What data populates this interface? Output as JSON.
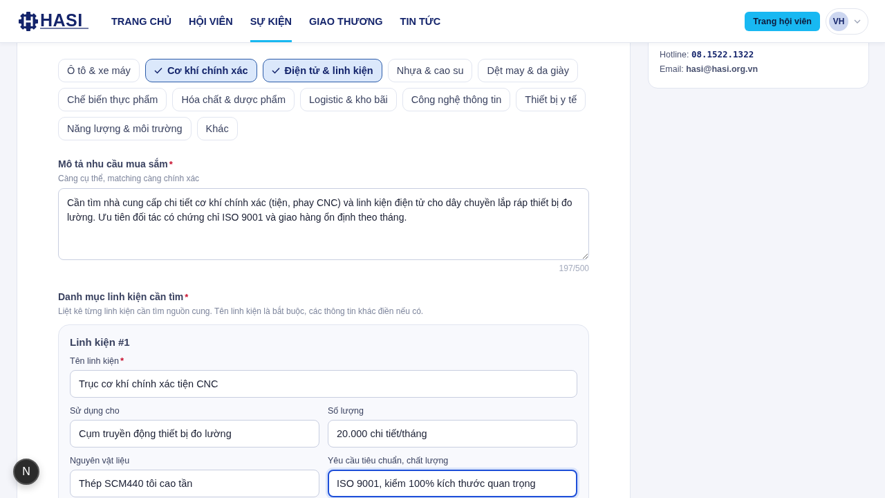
{
  "header": {
    "logo": "HASI",
    "nav": [
      {
        "label": "TRANG CHỦ",
        "selected": false
      },
      {
        "label": "HỘI VIÊN",
        "selected": false
      },
      {
        "label": "SỰ KIỆN",
        "selected": true
      },
      {
        "label": "GIAO THƯƠNG",
        "selected": false
      },
      {
        "label": "TIN TỨC",
        "selected": false
      }
    ],
    "member_button": "Trang hội viên",
    "avatar": "VH"
  },
  "form": {
    "industries": {
      "chips": [
        {
          "label": "Ô tô & xe máy",
          "selected": false
        },
        {
          "label": "Cơ khí chính xác",
          "selected": true
        },
        {
          "label": "Điện tử & linh kiện",
          "selected": true
        },
        {
          "label": "Nhựa & cao su",
          "selected": false
        },
        {
          "label": "Dệt may & da giày",
          "selected": false
        },
        {
          "label": "Chế biến thực phẩm",
          "selected": false
        },
        {
          "label": "Hóa chất & dược phẩm",
          "selected": false
        },
        {
          "label": "Logistic & kho bãi",
          "selected": false
        },
        {
          "label": "Công nghệ thông tin",
          "selected": false
        },
        {
          "label": "Thiết bị y tế",
          "selected": false
        },
        {
          "label": "Năng lượng & môi trường",
          "selected": false
        },
        {
          "label": "Khác",
          "selected": false
        }
      ]
    },
    "description": {
      "label": "Mô tả nhu cầu mua sắm",
      "required_mark": "*",
      "hint": "Càng cụ thể, matching càng chính xác",
      "value": "Cần tìm nhà cung cấp chi tiết cơ khí chính xác (tiện, phay CNC) và linh kiện điện tử cho dây chuyền lắp ráp thiết bị đo lường. Ưu tiên đối tác có chứng chỉ ISO 9001 và giao hàng ổn định theo tháng.",
      "counter": "197/500"
    },
    "components": {
      "label": "Danh mục linh kiện cần tìm",
      "required_mark": "*",
      "hint": "Liệt kê từng linh kiện cần tìm nguồn cung. Tên linh kiện là bắt buộc, các thông tin khác điền nếu có.",
      "items": [
        {
          "title": "Linh kiện #1",
          "fields": [
            {
              "label": "Tên linh kiện",
              "required_mark": "*",
              "value": "Trục cơ khí chính xác tiện CNC",
              "focused": false,
              "wide": true
            },
            {
              "label": "Sử dụng cho",
              "value": "Cụm truyền động thiết bị đo lường",
              "focused": false,
              "wide": false
            },
            {
              "label": "Số lượng",
              "value": "20.000 chi tiết/tháng",
              "focused": false,
              "wide": false
            },
            {
              "label": "Nguyên vật liệu",
              "value": "Thép SCM440 tôi cao tần",
              "focused": false,
              "wide": false
            },
            {
              "label": "Yêu cầu tiêu chuẩn, chất lượng",
              "value": "ISO 9001, kiểm 100% kích thước quan trọng",
              "focused": true,
              "wide": false
            }
          ]
        }
      ]
    }
  },
  "support": {
    "hotline_label": "Hotline:",
    "hotline": "08.1522.1322",
    "email_label": "Email:",
    "email": "hasi@hasi.org.vn"
  },
  "dev_badge": "N"
}
